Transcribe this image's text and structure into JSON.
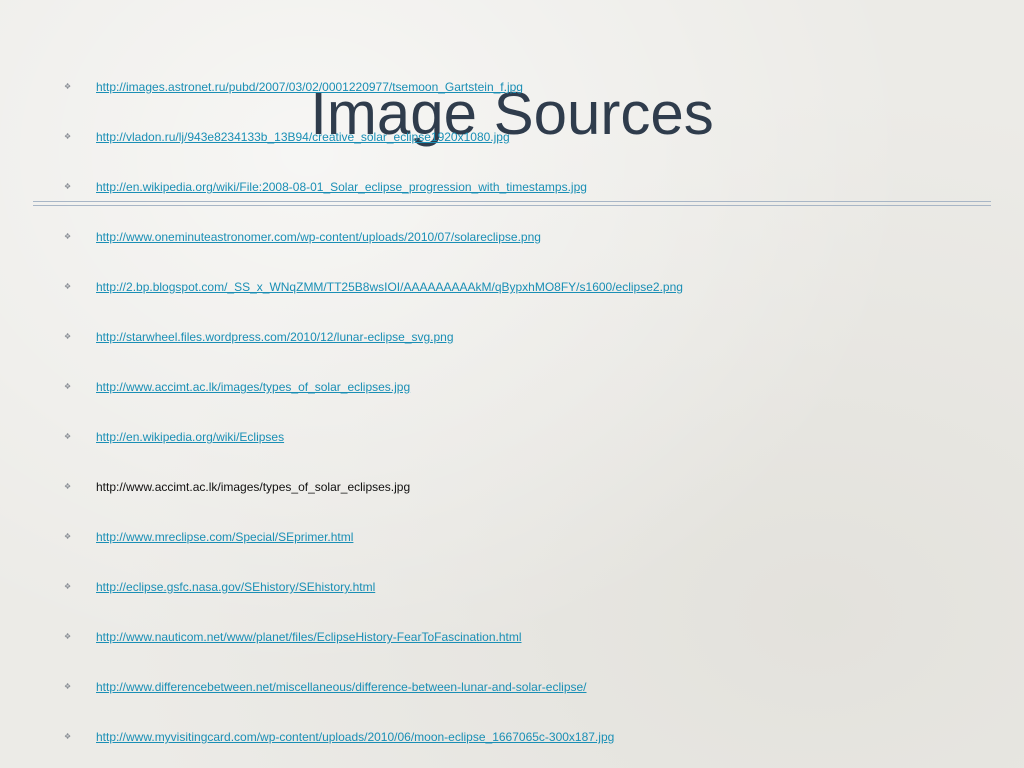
{
  "slide": {
    "title": "Image Sources"
  },
  "sources": [
    {
      "text": "http://images.astronet.ru/pubd/2007/03/02/0001220977/tsemoon_Gartstein_f.jpg",
      "link": true
    },
    {
      "text": "http://vladon.ru/lj/943e8234133b_13B94/creative_solar_eclipse1920x1080.jpg",
      "link": true
    },
    {
      "text": "http://en.wikipedia.org/wiki/File:2008-08-01_Solar_eclipse_progression_with_timestamps.jpg",
      "link": true
    },
    {
      "text": "http://www.oneminuteastronomer.com/wp-content/uploads/2010/07/solareclipse.png",
      "link": true
    },
    {
      "text": "http://2.bp.blogspot.com/_SS_x_WNqZMM/TT25B8wsIOI/AAAAAAAAAkM/qBypxhMO8FY/s1600/eclipse2.png",
      "link": true
    },
    {
      "text": "http://starwheel.files.wordpress.com/2010/12/lunar-eclipse_svg.png",
      "link": true
    },
    {
      "text": "http://www.accimt.ac.lk/images/types_of_solar_eclipses.jpg",
      "link": true
    },
    {
      "text": "http://en.wikipedia.org/wiki/Eclipses",
      "link": true
    },
    {
      "text": "http://www.accimt.ac.lk/images/types_of_solar_eclipses.jpg",
      "link": false
    },
    {
      "text": "http://www.mreclipse.com/Special/SEprimer.html",
      "link": true
    },
    {
      "text": "http://eclipse.gsfc.nasa.gov/SEhistory/SEhistory.html",
      "link": true
    },
    {
      "text": "http://www.nauticom.net/www/planet/files/EclipseHistory-FearToFascination.html",
      "link": true
    },
    {
      "text": "http://www.differencebetween.net/miscellaneous/difference-between-lunar-and-solar-eclipse/",
      "link": true
    },
    {
      "text": "http://www.myvisitingcard.com/wp-content/uploads/2010/06/moon-eclipse_1667065c-300x187.jpg",
      "link": true
    }
  ],
  "bullet_glyph": "❖",
  "colors": {
    "title": "#2f3c4c",
    "link": "#1a8fb5",
    "plain_text": "#111111",
    "divider": "#a8b6c6"
  }
}
